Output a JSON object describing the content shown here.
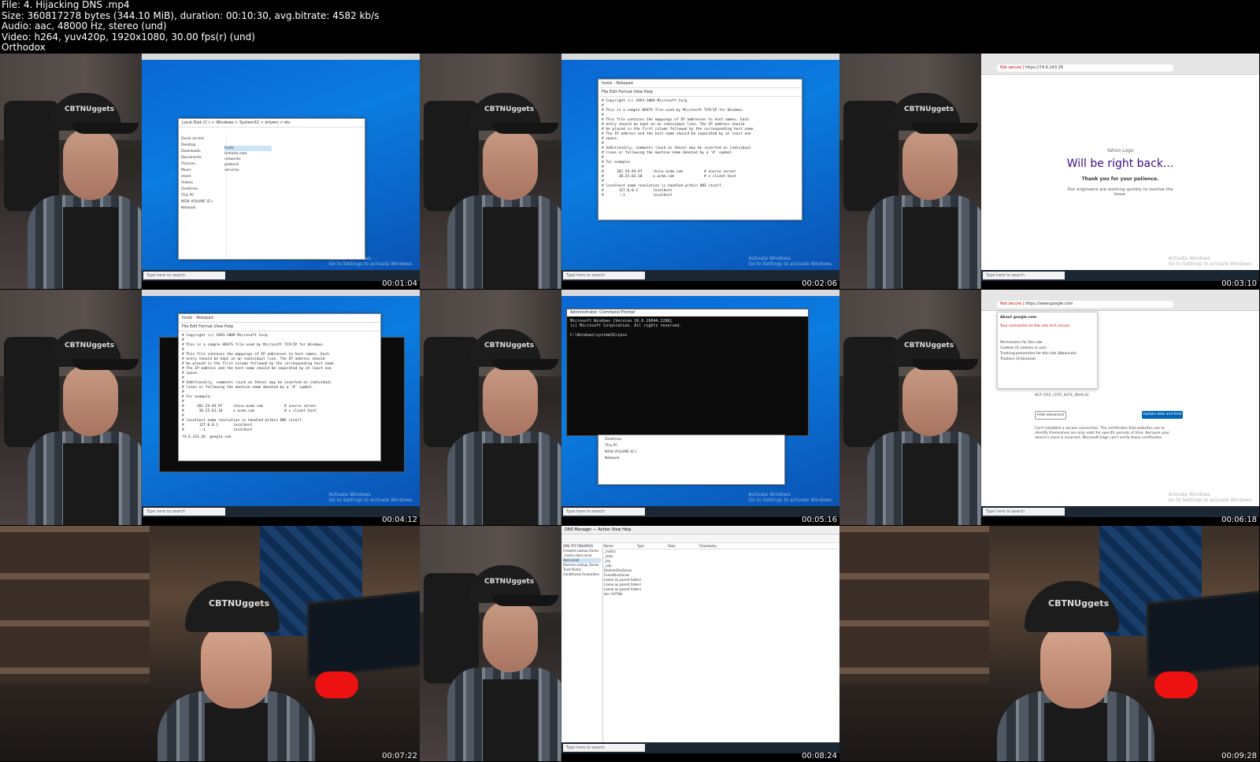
{
  "header": {
    "file": "File: 4. Hijacking DNS .mp4",
    "size": "Size: 360817278 bytes (344.10 MiB), duration: 00:10:30, avg.bitrate: 4582 kb/s",
    "audio": "Audio: aac, 48000 Hz, stereo (und)",
    "video": "Video: h264, yuv420p, 1920x1080, 30.00 fps(r) (und)",
    "author": "Orthodox"
  },
  "thumbnails": [
    {
      "timestamp": "00:01:04"
    },
    {
      "timestamp": "00:02:06"
    },
    {
      "timestamp": "00:03:10"
    },
    {
      "timestamp": "00:04:12"
    },
    {
      "timestamp": "00:05:16"
    },
    {
      "timestamp": "00:06:18"
    },
    {
      "timestamp": "00:07:22"
    },
    {
      "timestamp": "00:08:24"
    },
    {
      "timestamp": "00:09:28"
    }
  ],
  "screen_text": {
    "cap_logo": "CBTNUggets",
    "taskbar_search": "Type here to search",
    "activate_line1": "Activate Windows",
    "activate_line2": "Go to Settings to activate Windows.",
    "notepad_title": "hosts - Notepad",
    "notepad_menu": "File  Edit  Format  View  Help",
    "hosts_file": "# Copyright (c) 1993-2009 Microsoft Corp.\n#\n# This is a sample HOSTS file used by Microsoft TCP/IP for Windows.\n#\n# This file contains the mappings of IP addresses to host names. Each\n# entry should be kept on an individual line. The IP address should\n# be placed in the first column followed by the corresponding host name.\n# The IP address and the host name should be separated by at least one\n# space.\n#\n# Additionally, comments (such as these) may be inserted on individual\n# lines or following the machine name denoted by a '#' symbol.\n#\n# For example:\n#\n#      102.54.94.97     rhino.acme.com          # source server\n#       38.25.63.10     x.acme.com              # x client host\n#\n# localhost name resolution is handled within DNS itself.\n#\t127.0.0.1       localhost\n#\t::1             localhost",
    "hosts_added": "74.6.143.26  google.com",
    "cmd_title": "Administrator: Command Prompt",
    "cmd_text": "Microsoft Windows [Version 10.0.19044.1288]\n(c) Microsoft Corporation. All rights reserved.\n\nC:\\Windows\\system32>ipco",
    "explorer_path": "Local Disk (C:) > Windows > System32 > drivers > etc",
    "explorer_files": [
      "hosts",
      "lmhosts.sam",
      "networks",
      "protocol",
      "services"
    ],
    "explorer_nav": [
      "Quick access",
      "Desktop",
      "Downloads",
      "Documents",
      "Pictures",
      "Music",
      "share",
      "Videos",
      "OneDrive",
      "This PC",
      "NEW VOLUME (E:)",
      "Network"
    ],
    "yahoo_logo": "Yahoo Logo",
    "yahoo_heading": "Will be right back...",
    "yahoo_thanks": "Thank you for your patience.",
    "yahoo_sub": "Our engineers are working quickly to resolve the issue.",
    "yahoo_url": "https://74.6.143.26",
    "not_secure": "Not secure",
    "google_url": "https://www.google.com",
    "google_popup_title": "About google.com",
    "google_popup_warn": "Your connection to this site isn't secure",
    "google_popup_items": [
      "Permissions for this site",
      "Cookies (0 cookies in use)",
      "Tracking prevention for this site (Balanced)",
      "Trackers (0 blocked)"
    ],
    "google_err": "NET::ERR_CERT_DATE_INVALID",
    "google_adv": "Hide advanced",
    "google_btn": "Update date and time",
    "google_body": "Can't establish a secure connection. The certificates that websites use to identify themselves are only valid for specific periods of time. Because your device's clock is incorrect, Microsoft Edge can't verify these certificates.",
    "dns_title": "DNS Manager",
    "dns_menu": "Action  View  Help",
    "dns_tree": [
      "WIN-7EF76BLBRHS",
      "Forward Lookup Zones",
      "_msdcs.doca.local",
      "doca.local",
      "Reverse Lookup Zones",
      "Trust Points",
      "Conditional Forwarders"
    ],
    "dns_cols": [
      "Name",
      "Type",
      "Data",
      "Timestamp"
    ],
    "dns_rows": [
      "_msdcs",
      "_sites",
      "_tcp",
      "_udp",
      "DomainDnsZones",
      "ForestDnsZones",
      "(same as parent folder)",
      "(same as parent folder)",
      "(same as parent folder)",
      "win-7ef76bl"
    ]
  }
}
